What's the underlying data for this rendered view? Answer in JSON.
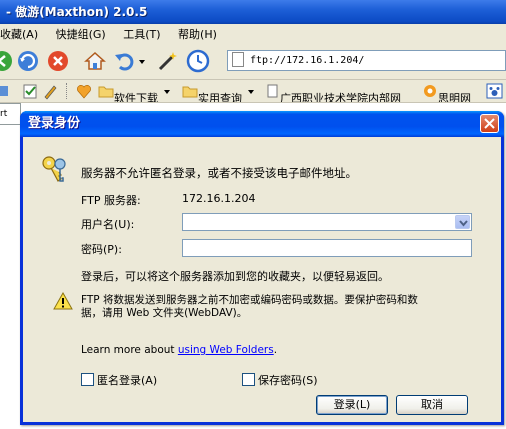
{
  "window": {
    "title": "- 傲游(Maxthon) 2.0.5"
  },
  "menu": [
    "收藏(A)",
    "快捷组(G)",
    "工具(T)",
    "帮助(H)"
  ],
  "address": {
    "value": "ftp://172.16.1.204/"
  },
  "favorites": [
    {
      "label": "软件下载",
      "icon": "folder-icon"
    },
    {
      "label": "实用查询",
      "icon": "folder-icon"
    },
    {
      "label": "广西职业技术学院内部网",
      "icon": "page-icon"
    },
    {
      "label": "思明网",
      "icon": "site-icon"
    }
  ],
  "tab": {
    "label": "rt"
  },
  "dialog": {
    "title": "登录身份",
    "message": "服务器不允许匿名登录，或者不接受该电子邮件地址。",
    "server_label": "FTP 服务器:",
    "server_value": "172.16.1.204",
    "username_label": "用户名(U):",
    "username_value": "",
    "password_label": "密码(P):",
    "password_value": "",
    "info": "登录后，可以将这个服务器添加到您的收藏夹，以便轻易返回。",
    "warning_line1": "FTP 将数据发送到服务器之前不加密或编码密码或数据。要保护密码和数",
    "warning_line2": "据，请用 Web 文件夹(WebDAV)。",
    "learn_prefix": "Learn more about",
    "learn_link": "using Web Folders",
    "learn_suffix": ".",
    "anonymous_label": "匿名登录(A)",
    "anonymous_checked": false,
    "save_password_label": "保存密码(S)",
    "save_password_checked": false,
    "login_button": "登录(L)",
    "cancel_button": "取消"
  },
  "colors": {
    "titlebar": "#0053ee",
    "dialog_bg": "#ece9d8",
    "link": "#0000ff"
  }
}
